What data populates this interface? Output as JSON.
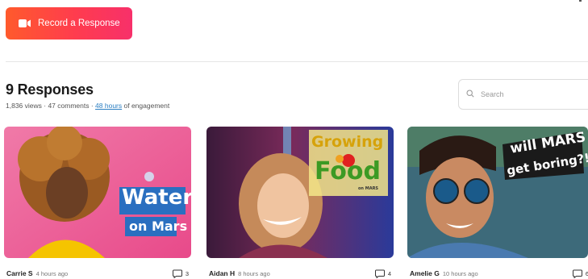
{
  "header": {
    "record_button_label": "Record a Response",
    "accent_gradient": [
      "#ff5a2c",
      "#f7306a"
    ]
  },
  "responses": {
    "title": "9 Responses",
    "views": "1,836 views",
    "comments": "47 comments",
    "engagement_hours": "48 hours",
    "engagement_suffix": " of engagement",
    "separator": " · "
  },
  "search": {
    "placeholder": "Search",
    "icon": "search-icon"
  },
  "cards": [
    {
      "name": "Carrie S",
      "time": "4 hours ago",
      "comment_count": "3",
      "thumb_line1": "Water",
      "thumb_line2": "on Mars"
    },
    {
      "name": "Aidan H",
      "time": "8 hours ago",
      "comment_count": "4",
      "thumb_line1": "Growing",
      "thumb_line2": "Food",
      "thumb_line3": "on MARS"
    },
    {
      "name": "Amelie G",
      "time": "10 hours ago",
      "comment_count": "6",
      "thumb_line1": "will MARS",
      "thumb_line2": "get boring?!"
    }
  ]
}
